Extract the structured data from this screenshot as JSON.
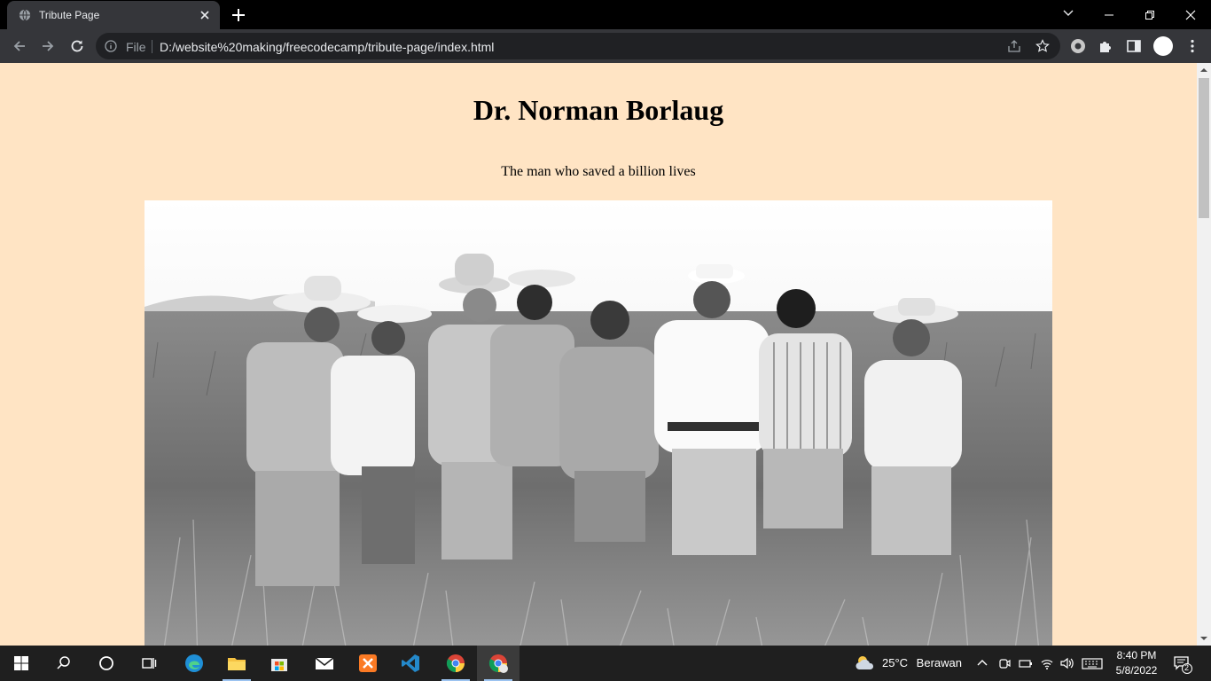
{
  "browser": {
    "tab_title": "Tribute Page",
    "omnibox": {
      "scheme": "File",
      "url": "D:/website%20making/freecodecamp/tribute-page/index.html"
    }
  },
  "page": {
    "title": "Dr. Norman Borlaug",
    "tagline": "The man who saved a billion lives",
    "background_color": "#ffe4c4",
    "image_alt": "Dr. Norman Borlaug with farmers in a wheat field"
  },
  "taskbar": {
    "weather": {
      "temperature": "25°C",
      "condition": "Berawan"
    },
    "clock": {
      "time": "8:40 PM",
      "date": "5/8/2022"
    },
    "notification_count": "2",
    "apps": [
      "start",
      "search",
      "cortana",
      "task-view",
      "edge",
      "file-explorer",
      "microsoft-store",
      "mail",
      "xampp",
      "vscode",
      "chrome",
      "chrome-active"
    ]
  }
}
